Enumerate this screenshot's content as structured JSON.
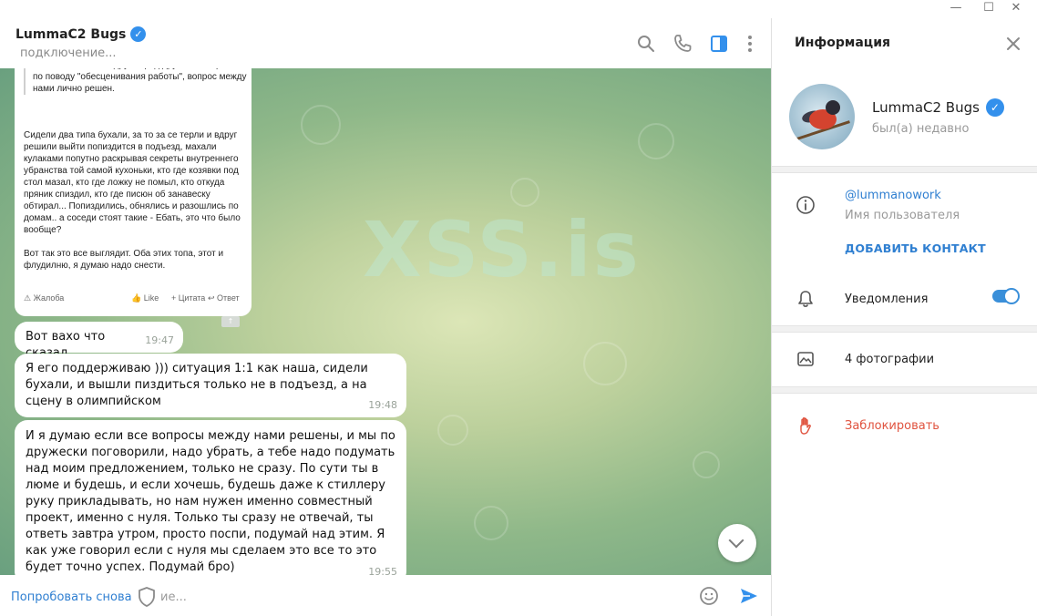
{
  "window": {
    "controls": {
      "minimize": "—",
      "maximize": "☐",
      "close": "✕"
    }
  },
  "chat": {
    "title": "LummaC2 Bugs",
    "status": "подключение...",
    "watermark": "XSS.is",
    "screenshot": {
      "quote": "Извинились за это друг перед другом. Конкретно по поводу \"обесценивания работы\", вопрос между нами лично решен.",
      "paragraphs": [
        "Сидели два типа бухали, за то за се терли и вдруг решили выйти попиздится в подъезд, махали кулаками попутно раскрывая секреты внутреннего убранства той самой кухоньки, кто где козявки под стол мазал, кто где ложку не помыл, кто откуда пряник спиздил, кто где писюн об занавеску обтирал... Попиздились, обнялись и разошлись по домам.. а соседи стоят такие - Ебать, это что было вообще?",
        "Вот так это все выглядит. Оба этих топа, этот и флудилню, я думаю надо снести."
      ],
      "complaint": "Жалоба",
      "like": "Like",
      "quote_action": "Цитата",
      "reply": "Ответ"
    },
    "messages": [
      {
        "text": "Вот вахо что сказал",
        "time": "19:47"
      },
      {
        "text": "Я его поддерживаю ))) ситуация 1:1 как наша, сидели бухали, и вышли пиздиться только не в подъезд, а на сцену в олимпийском",
        "time": "19:48"
      },
      {
        "text": "И я думаю если все вопросы между нами решены, и мы по дружески поговорили, надо убрать, а тебе надо подумать над моим предложением, только не сразу. По сути ты в люме и будешь, и если хочешь, будешь даже к стиллеру руку прикладывать, но нам нужен именно совместный проект, именно с нуля. Только ты сразу не отвечай, ты ответь завтра утром, просто поспи, подумай над этим. Я как уже говорил если с нуля мы сделаем это все то это будет точно успех. Подумай бро)",
        "time": "19:55"
      }
    ],
    "composer": {
      "retry": "Попробовать снова",
      "placeholder": "ие..."
    },
    "accent": "#3390ec"
  },
  "info": {
    "title": "Информация",
    "name": "LummaC2 Bugs",
    "last_seen": "был(а) недавно",
    "username": "@lummanowork",
    "username_label": "Имя пользователя",
    "add_contact": "ДОБАВИТЬ КОНТАКТ",
    "notifications": "Уведомления",
    "notifications_on": true,
    "photos": "4 фотографии",
    "block": "Заблокировать"
  }
}
